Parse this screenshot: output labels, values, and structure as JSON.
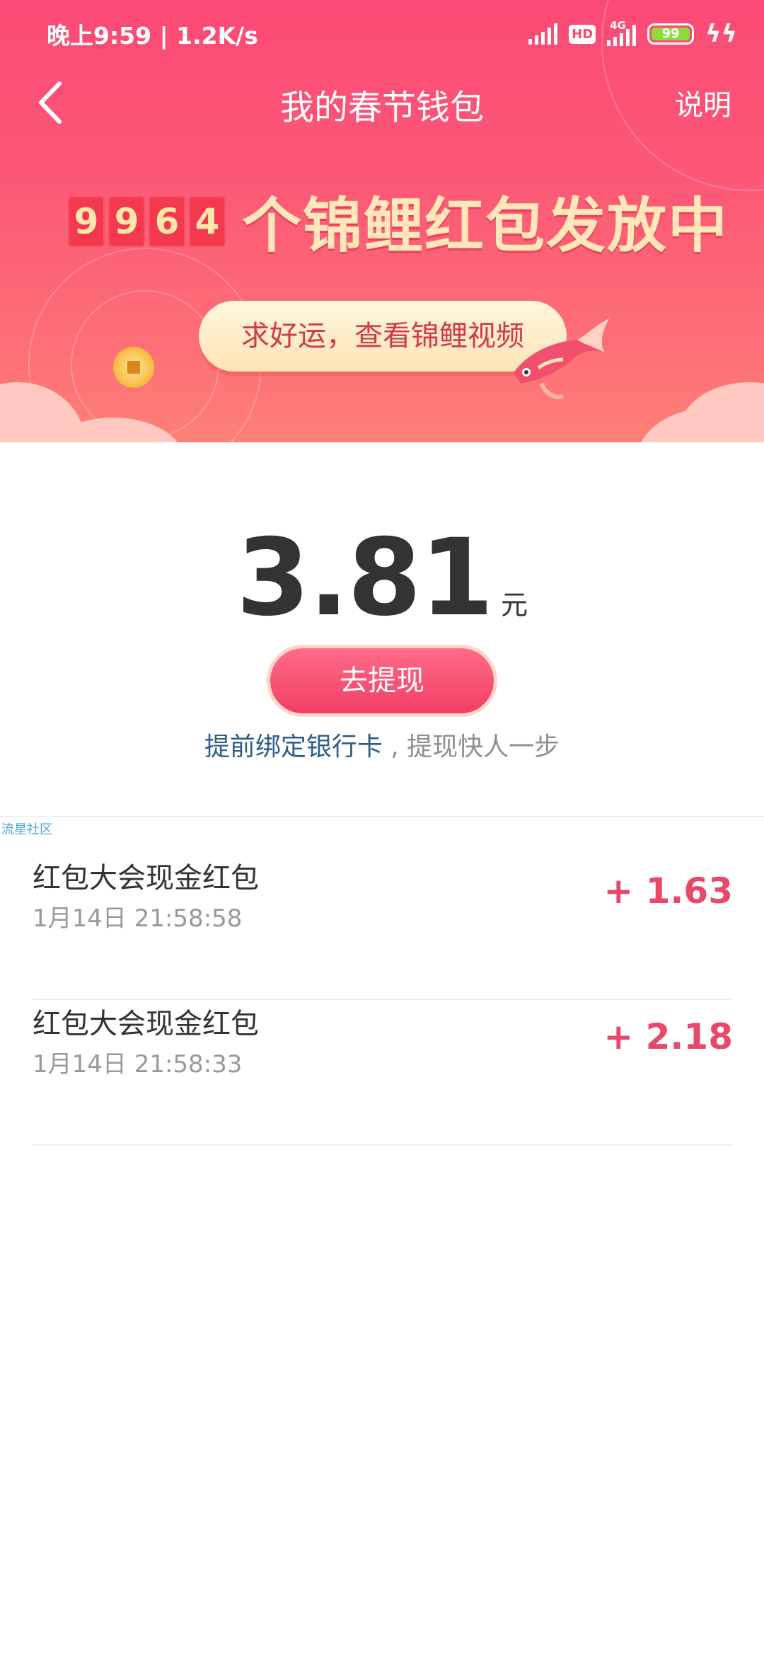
{
  "status_bar": {
    "time": "晚上9:59 | 1.2K/s",
    "hd_label": "HD",
    "network_label": "4G",
    "battery": "99",
    "charging_icon": "bolt-icon"
  },
  "nav": {
    "back_icon": "chevron-left-icon",
    "title": "我的春节钱包",
    "explain_label": "说明"
  },
  "banner": {
    "counter_digits": [
      "9",
      "9",
      "6",
      "4"
    ],
    "counter_text": "个锦鲤红包发放中",
    "luck_button": "求好运，查看锦鲤视频"
  },
  "wallet": {
    "amount": "3.81",
    "unit": "元",
    "withdraw_label": "去提现",
    "bind_link": "提前绑定银行卡",
    "bind_hint": " , 提现快人一步"
  },
  "watermark": "流星社区",
  "records": [
    {
      "title": "红包大会现金红包",
      "time": "1月14日 21:58:58",
      "amount": "+ 1.63"
    },
    {
      "title": "红包大会现金红包",
      "time": "1月14日 21:58:33",
      "amount": "+ 2.18"
    }
  ],
  "colors": {
    "brand_pink": "#fb4975",
    "amount_pink": "#e8496b",
    "link_blue": "#2d5d88",
    "gold_text": "#ffe7ba"
  }
}
